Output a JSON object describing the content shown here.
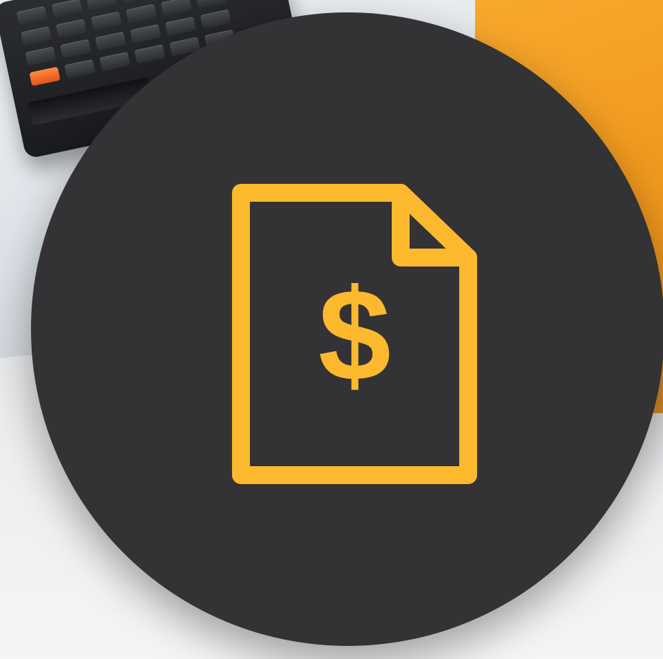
{
  "icon": {
    "name": "invoice-dollar-icon",
    "symbol": "$",
    "stroke_color": "#FDB92E"
  },
  "background": {
    "circle_color": "#333234",
    "accent_color": "#F29A1F"
  }
}
